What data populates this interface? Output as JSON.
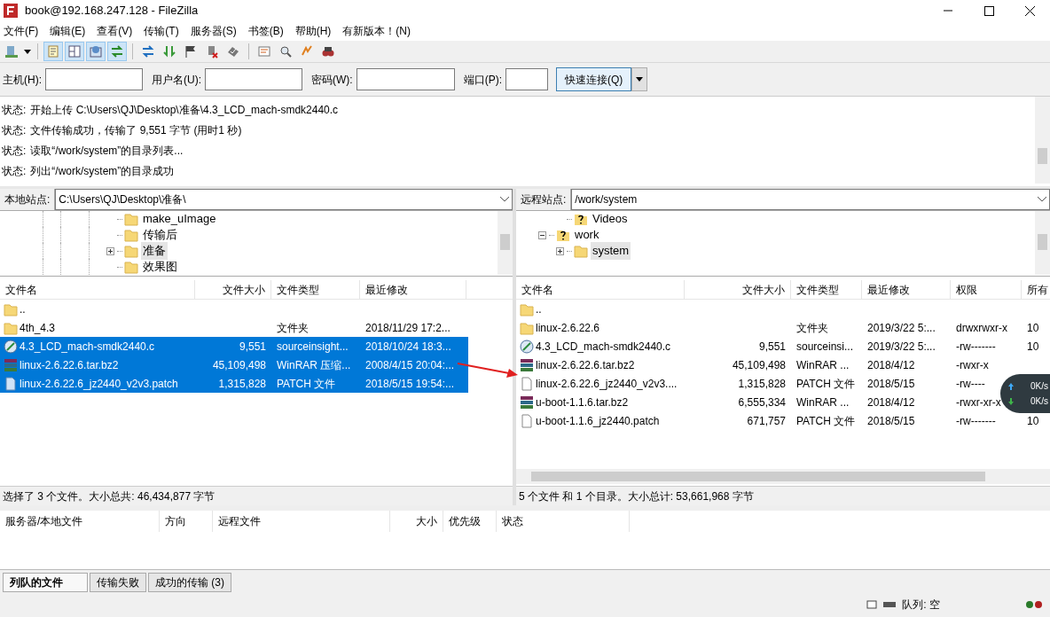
{
  "window": {
    "title": "book@192.168.247.128 - FileZilla"
  },
  "menu": [
    "文件(F)",
    "编辑(E)",
    "查看(V)",
    "传输(T)",
    "服务器(S)",
    "书签(B)",
    "帮助(H)",
    "有新版本！(N)"
  ],
  "toolbar": [
    {
      "on": false
    },
    {
      "on": true
    },
    {
      "on": true
    },
    {
      "on": true
    },
    {
      "on": true
    },
    {
      "on": false
    },
    {
      "on": false
    },
    {
      "on": false
    },
    {
      "on": false
    },
    {
      "on": false
    },
    {
      "on": false
    },
    {
      "on": false
    },
    {
      "on": false
    },
    {
      "on": false
    }
  ],
  "quickconnect": {
    "fields": [
      {
        "label": "主机(H):"
      },
      {
        "label": "用户名(U):"
      },
      {
        "label": "密码(W):"
      },
      {
        "label": "端口(P):"
      }
    ],
    "button": "快速连接(Q)"
  },
  "log": [
    {
      "label": "状态:",
      "text": "开始上传 C:\\Users\\QJ\\Desktop\\准备\\4.3_LCD_mach-smdk2440.c"
    },
    {
      "label": "状态:",
      "text": "文件传输成功，传输了 9,551 字节 (用时1 秒)"
    },
    {
      "label": "状态:",
      "text": "读取“/work/system”的目录列表..."
    },
    {
      "label": "状态:",
      "text": "列出“/work/system”的目录成功"
    }
  ],
  "local": {
    "site_label": "本地站点:",
    "path": "C:\\Users\\QJ\\Desktop\\准备\\",
    "tree": [
      {
        "name": "make_uImage",
        "expandable": false,
        "selected": false
      },
      {
        "name": "传输后",
        "expandable": false,
        "selected": false
      },
      {
        "name": "准备",
        "expandable": true,
        "selected": true
      },
      {
        "name": "效果图",
        "expandable": false,
        "selected": false
      }
    ],
    "columns": [
      "文件名",
      "文件大小",
      "文件类型",
      "最近修改"
    ],
    "rows": [
      {
        "kind": "folder",
        "name": "..",
        "size": "",
        "type": "",
        "modified": "",
        "selected": false
      },
      {
        "kind": "folder",
        "name": "4th_4.3",
        "size": "",
        "type": "文件夹",
        "modified": "2018/11/29 17:2...",
        "selected": false
      },
      {
        "kind": "source",
        "name": "4.3_LCD_mach-smdk2440.c",
        "size": "9,551",
        "type": "sourceinsight...",
        "modified": "2018/10/24 18:3...",
        "selected": true
      },
      {
        "kind": "archive",
        "name": "linux-2.6.22.6.tar.bz2",
        "size": "45,109,498",
        "type": "WinRAR 压缩...",
        "modified": "2008/4/15 20:04:...",
        "selected": true
      },
      {
        "kind": "patch",
        "name": "linux-2.6.22.6_jz2440_v2v3.patch",
        "size": "1,315,828",
        "type": "PATCH 文件",
        "modified": "2018/5/15 19:54:...",
        "selected": true
      }
    ],
    "status": "选择了 3 个文件。大小总共: 46,434,877 字节"
  },
  "remote": {
    "site_label": "远程站点:",
    "path": "/work/system",
    "tree": [
      {
        "name": "Videos",
        "unknown": true,
        "selected": false
      },
      {
        "name": "work",
        "unknown": true,
        "expanded": true,
        "selected": false,
        "children": [
          {
            "name": "system",
            "unknown": false,
            "expanded": false,
            "selected": true
          }
        ]
      }
    ],
    "columns": [
      "文件名",
      "文件大小",
      "文件类型",
      "最近修改",
      "权限",
      "所有"
    ],
    "rows": [
      {
        "kind": "folder",
        "name": "..",
        "size": "",
        "type": "",
        "modified": "",
        "perms": "",
        "owner": ""
      },
      {
        "kind": "folder",
        "name": "linux-2.6.22.6",
        "size": "",
        "type": "文件夹",
        "modified": "2019/3/22 5:...",
        "perms": "drwxrwxr-x",
        "owner": "10"
      },
      {
        "kind": "source",
        "name": "4.3_LCD_mach-smdk2440.c",
        "size": "9,551",
        "type": "sourceinsi...",
        "modified": "2019/3/22 5:...",
        "perms": "-rw-------",
        "owner": "10"
      },
      {
        "kind": "archive",
        "name": "linux-2.6.22.6.tar.bz2",
        "size": "45,109,498",
        "type": "WinRAR ...",
        "modified": "2018/4/12",
        "perms": "-rwxr-x",
        "owner": ""
      },
      {
        "kind": "doc",
        "name": "linux-2.6.22.6_jz2440_v2v3....",
        "size": "1,315,828",
        "type": "PATCH 文件",
        "modified": "2018/5/15",
        "perms": "-rw----",
        "owner": ""
      },
      {
        "kind": "archive",
        "name": "u-boot-1.1.6.tar.bz2",
        "size": "6,555,334",
        "type": "WinRAR ...",
        "modified": "2018/4/12",
        "perms": "-rwxr-xr-x",
        "owner": ""
      },
      {
        "kind": "doc",
        "name": "u-boot-1.1.6_jz2440.patch",
        "size": "671,757",
        "type": "PATCH 文件",
        "modified": "2018/5/15",
        "perms": "-rw-------",
        "owner": "10"
      }
    ],
    "status": "5 个文件 和 1 个目录。大小总计: 53,661,968 字节"
  },
  "speed": {
    "up": "0K/s",
    "down": "0K/s"
  },
  "queue": {
    "columns": [
      "服务器/本地文件",
      "方向",
      "远程文件",
      "大小",
      "优先级",
      "状态"
    ],
    "tabs": [
      {
        "label": "列队的文件",
        "selected": true
      },
      {
        "label": "传输失败",
        "selected": false
      },
      {
        "label": "成功的传输 (3)",
        "selected": false
      }
    ],
    "status": "队列: 空"
  }
}
